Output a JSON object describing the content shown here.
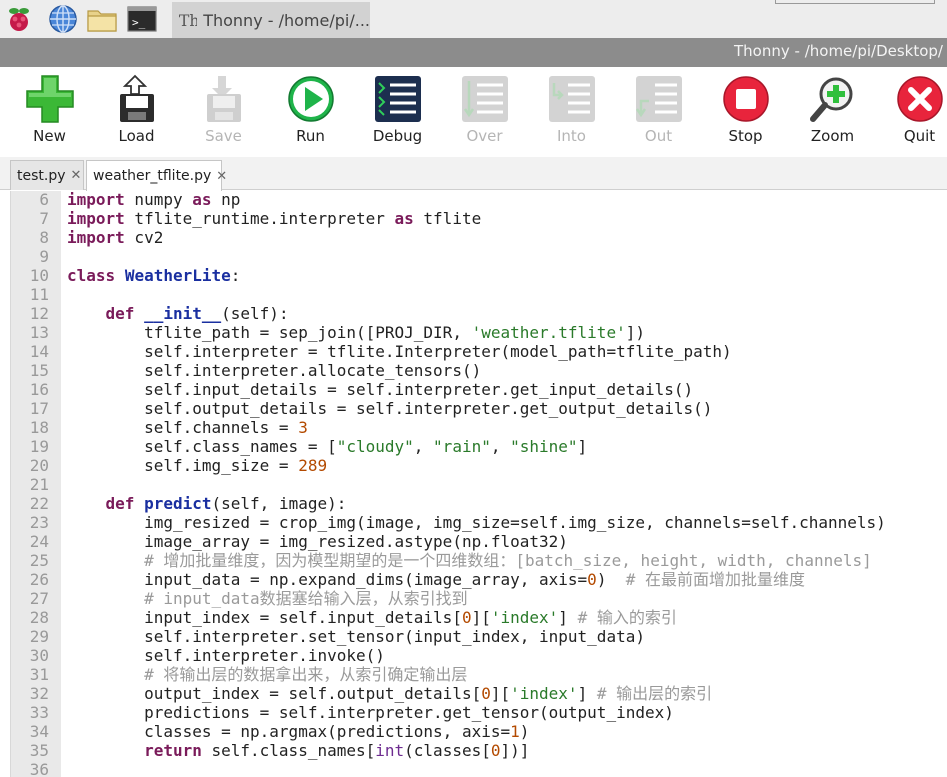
{
  "taskbar": {
    "task_title": "Thonny  -  /home/pi/..."
  },
  "titlebar": {
    "title": "Thonny  -  /home/pi/Desktop/"
  },
  "toolbar": {
    "buttons": [
      {
        "label": "New",
        "icon": "new-file-icon",
        "enabled": true
      },
      {
        "label": "Load",
        "icon": "load-icon",
        "enabled": true
      },
      {
        "label": "Save",
        "icon": "save-icon",
        "enabled": false
      },
      {
        "label": "Run",
        "icon": "run-icon",
        "enabled": true
      },
      {
        "label": "Debug",
        "icon": "debug-icon",
        "enabled": true
      },
      {
        "label": "Over",
        "icon": "step-over-icon",
        "enabled": false
      },
      {
        "label": "Into",
        "icon": "step-into-icon",
        "enabled": false
      },
      {
        "label": "Out",
        "icon": "step-out-icon",
        "enabled": false
      },
      {
        "label": "Stop",
        "icon": "stop-icon",
        "enabled": true
      },
      {
        "label": "Zoom",
        "icon": "zoom-icon",
        "enabled": true
      },
      {
        "label": "Quit",
        "icon": "quit-icon",
        "enabled": true
      }
    ]
  },
  "tabs": [
    {
      "label": "test.py",
      "close": "✕",
      "active": false
    },
    {
      "label": "weather_tflite.py",
      "close": "✕",
      "active": true
    }
  ],
  "colors": {
    "keyword": "#7a1b5a",
    "string": "#2a7a2a",
    "number": "#b34a00",
    "comment": "#9a9a9a",
    "run_green": "#1fb44a",
    "stop_red": "#e8243c"
  },
  "editor": {
    "lines": [
      {
        "n": "6",
        "text": "import numpy as np"
      },
      {
        "n": "7",
        "text": "import tflite_runtime.interpreter as tflite"
      },
      {
        "n": "8",
        "text": "import cv2"
      },
      {
        "n": "9",
        "text": ""
      },
      {
        "n": "10",
        "text": "class WeatherLite:"
      },
      {
        "n": "11",
        "text": ""
      },
      {
        "n": "12",
        "text": "    def __init__(self):"
      },
      {
        "n": "13",
        "text": "        tflite_path = sep_join([PROJ_DIR, 'weather.tflite'])"
      },
      {
        "n": "14",
        "text": "        self.interpreter = tflite.Interpreter(model_path=tflite_path)"
      },
      {
        "n": "15",
        "text": "        self.interpreter.allocate_tensors()"
      },
      {
        "n": "16",
        "text": "        self.input_details = self.interpreter.get_input_details()"
      },
      {
        "n": "17",
        "text": "        self.output_details = self.interpreter.get_output_details()"
      },
      {
        "n": "18",
        "text": "        self.channels = 3"
      },
      {
        "n": "19",
        "text": "        self.class_names = [\"cloudy\", \"rain\", \"shine\"]"
      },
      {
        "n": "20",
        "text": "        self.img_size = 289"
      },
      {
        "n": "21",
        "text": ""
      },
      {
        "n": "22",
        "text": "    def predict(self, image):"
      },
      {
        "n": "23",
        "text": "        img_resized = crop_img(image, img_size=self.img_size, channels=self.channels)"
      },
      {
        "n": "24",
        "text": "        image_array = img_resized.astype(np.float32)"
      },
      {
        "n": "25",
        "text": "        # 增加批量维度，因为模型期望的是一个四维数组：[batch_size, height, width, channels]"
      },
      {
        "n": "26",
        "text": "        input_data = np.expand_dims(image_array, axis=0)  # 在最前面增加批量维度"
      },
      {
        "n": "27",
        "text": "        # input_data数据塞给输入层，从索引找到"
      },
      {
        "n": "28",
        "text": "        input_index = self.input_details[0]['index'] # 输入的索引"
      },
      {
        "n": "29",
        "text": "        self.interpreter.set_tensor(input_index, input_data)"
      },
      {
        "n": "30",
        "text": "        self.interpreter.invoke()"
      },
      {
        "n": "31",
        "text": "        # 将输出层的数据拿出来，从索引确定输出层"
      },
      {
        "n": "32",
        "text": "        output_index = self.output_details[0]['index'] # 输出层的索引"
      },
      {
        "n": "33",
        "text": "        predictions = self.interpreter.get_tensor(output_index)"
      },
      {
        "n": "34",
        "text": "        classes = np.argmax(predictions, axis=1)"
      },
      {
        "n": "35",
        "text": "        return self.class_names[int(classes[0])]"
      },
      {
        "n": "36",
        "text": ""
      }
    ]
  }
}
